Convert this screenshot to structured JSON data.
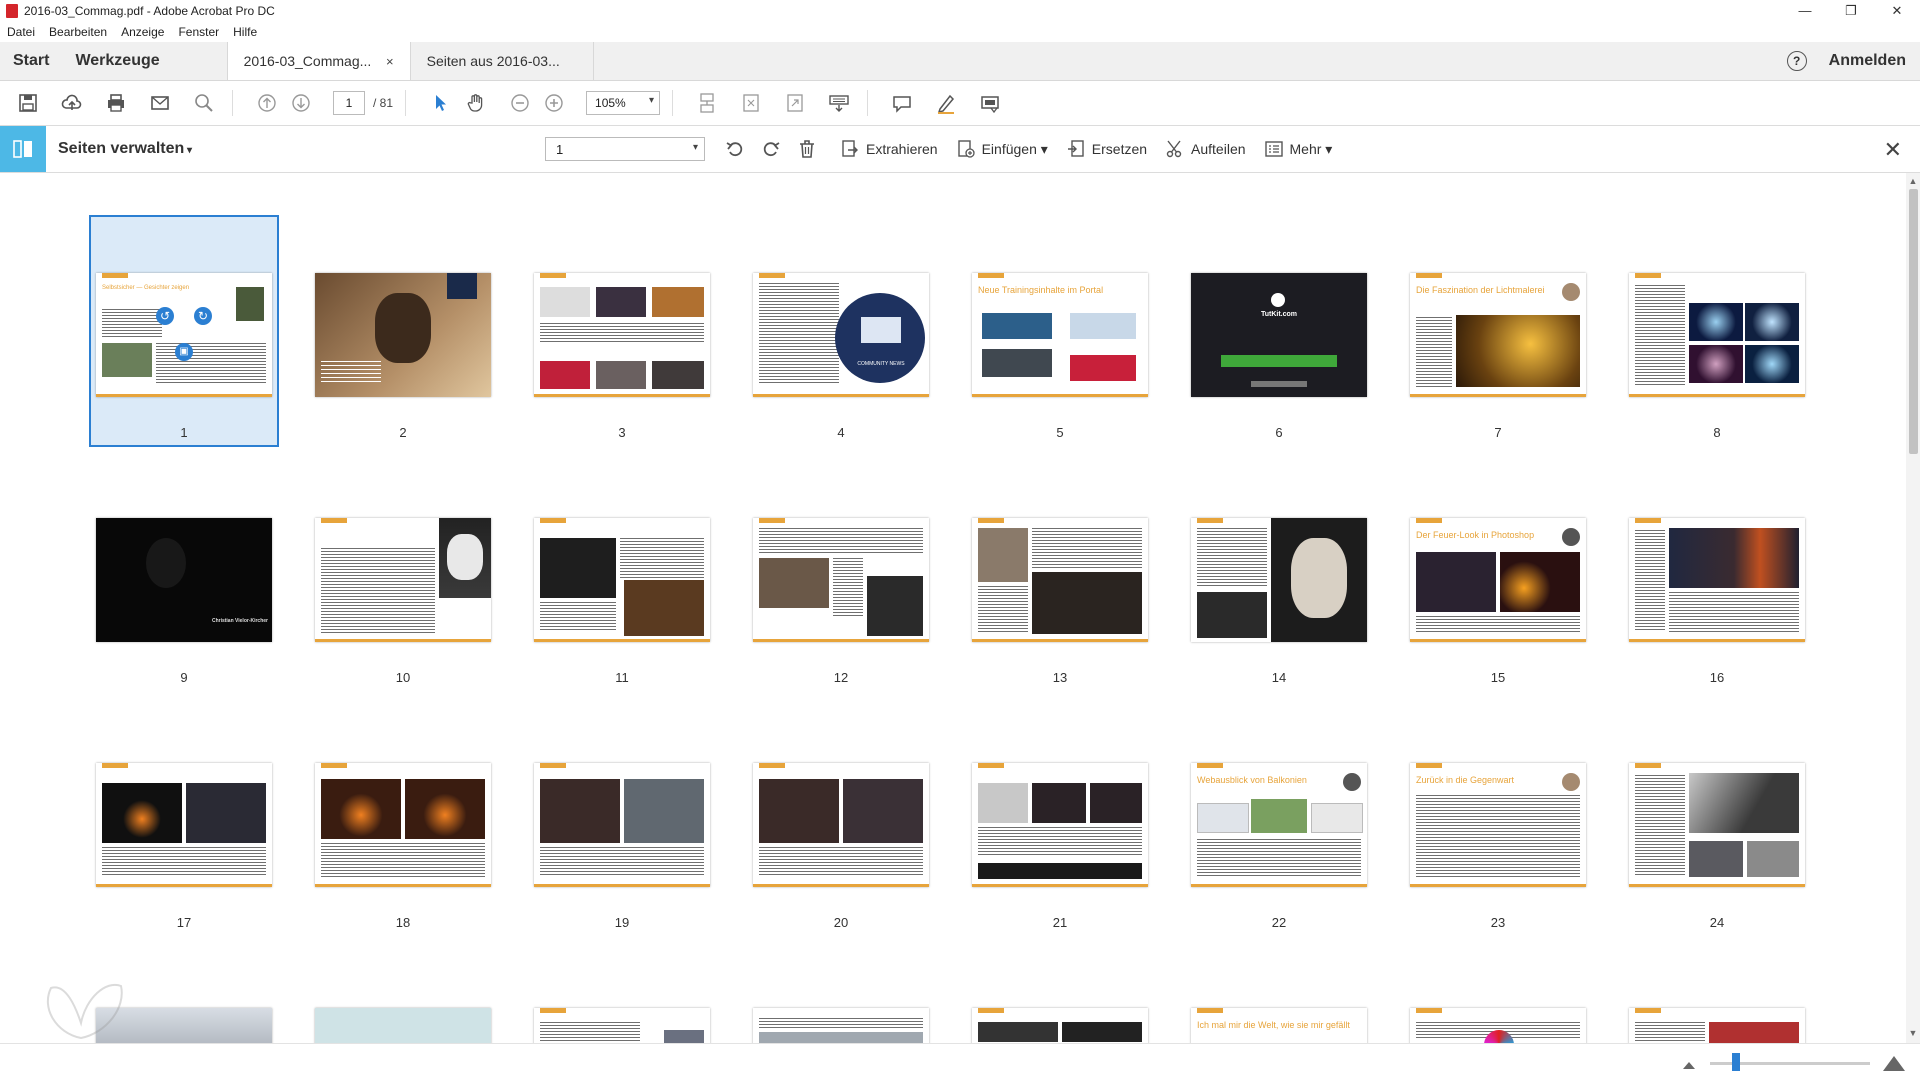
{
  "window": {
    "title": "2016-03_Commag.pdf - Adobe Acrobat Pro DC",
    "minimize": "—",
    "maximize": "❐",
    "close": "✕"
  },
  "menu": [
    "Datei",
    "Bearbeiten",
    "Anzeige",
    "Fenster",
    "Hilfe"
  ],
  "tabs": {
    "start": "Start",
    "tools": "Werkzeuge",
    "doc1": "2016-03_Commag...",
    "doc1_close": "×",
    "doc2": "Seiten aus 2016-03...",
    "help": "?",
    "signin": "Anmelden"
  },
  "toolbar": {
    "current_page": "1",
    "page_total": "/ 81",
    "zoom": "105%"
  },
  "page_manager": {
    "title": "Seiten verwalten",
    "page_select": "1",
    "extract": "Extrahieren",
    "insert": "Einfügen ▾",
    "replace": "Ersetzen",
    "split": "Aufteilen",
    "more": "Mehr ▾",
    "close": "✕"
  },
  "pages": [
    "1",
    "2",
    "3",
    "4",
    "5",
    "6",
    "7",
    "8",
    "9",
    "10",
    "11",
    "12",
    "13",
    "14",
    "15",
    "16",
    "17",
    "18",
    "19",
    "20",
    "21",
    "22",
    "23",
    "24"
  ],
  "page_text": {
    "p5": "Neue Trainingsinhalte im Portal",
    "p6": "TutKit.com",
    "p7": "Die Faszination der Lichtmalerei",
    "p15": "Der Feuer-Look in Photoshop",
    "p22": "Webausblick von Balkonien",
    "p23": "Zurück in die Gegenwart",
    "p4": "COMMUNITY NEWS",
    "p9": "Christian Vielor-Kircher",
    "p27": "Ich mal mir die Welt, wie sie mir gefällt"
  },
  "colors": {
    "accent": "#e7a43b",
    "select_border": "#2b7fd2",
    "tool_blue": "#4db8e6"
  }
}
